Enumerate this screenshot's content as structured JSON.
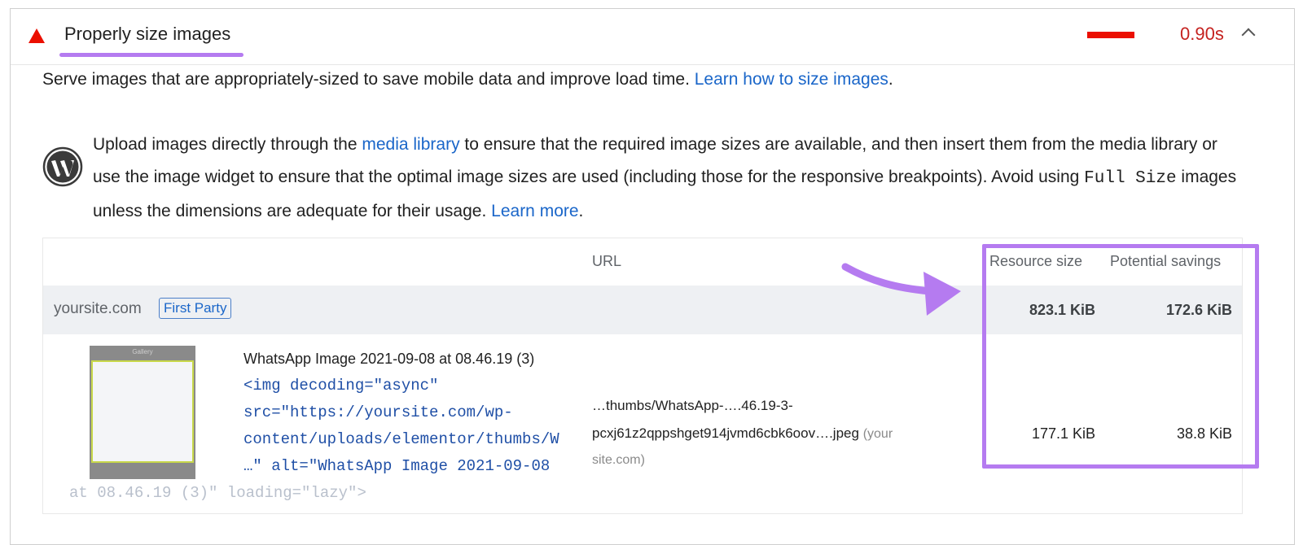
{
  "audit": {
    "title": "Properly size images",
    "value": "0.90s",
    "status_color": "#eb0f00",
    "accent_color": "#b57bf0"
  },
  "description": {
    "text": "Serve images that are appropriately-sized to save mobile data and improve load time. ",
    "link": "Learn how to size images",
    "end": "."
  },
  "wordpress_tip": {
    "icon": "wordpress-icon",
    "part1": "Upload images directly through the ",
    "link1": "media library",
    "part2": " to ensure that the required image sizes are available, and then insert them from the media library or use the image widget to ensure that the optimal image sizes are used (including those for the responsive breakpoints). Avoid using ",
    "code": "Full Size",
    "part3": " images unless the dimensions are adequate for their usage. ",
    "link2": "Learn more",
    "end": "."
  },
  "table": {
    "headers": {
      "url": "URL",
      "resource_size": "Resource size",
      "potential_savings": "Potential savings"
    },
    "group": {
      "name": "yoursite.com",
      "badge": "First Party",
      "resource_size": "823.1 KiB",
      "potential_savings": "172.6 KiB"
    },
    "rows": [
      {
        "thumbnail_label": "Gallery",
        "name": "WhatsApp Image 2021-09-08 at 08.46.19 (3)",
        "snippet_lines": [
          "<img decoding=\"async\"",
          "src=\"https://yoursite.com/wp-",
          "content/uploads/elementor/thumbs/W",
          "…\" alt=\"WhatsApp Image 2021-09-08",
          "at 08.46.19 (3)\" loading=\"lazy\">"
        ],
        "url_line1": "…thumbs/WhatsApp-….46.19-3-",
        "url_line2": "pcxj61z2qppshget914jvmd6cbk6oov….jpeg",
        "url_host_a": "(your",
        "url_host_b": "site.com)",
        "resource_size": "177.1 KiB",
        "potential_savings": "38.8 KiB"
      }
    ]
  }
}
